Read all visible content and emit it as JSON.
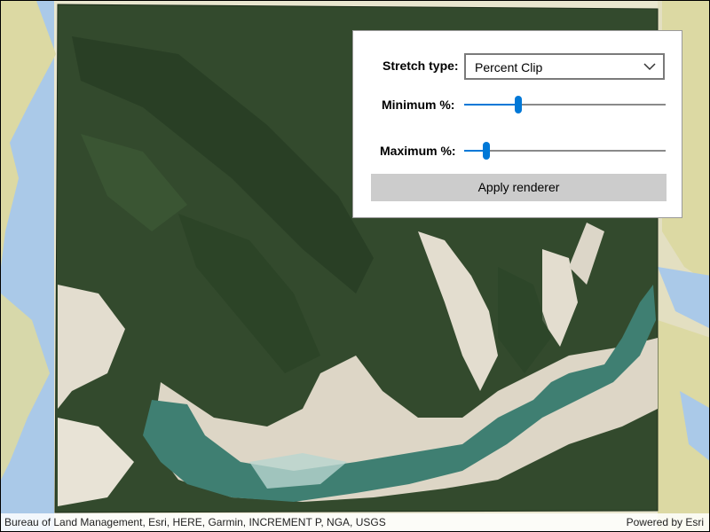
{
  "panel": {
    "stretch_label": "Stretch type:",
    "stretch_value": "Percent Clip",
    "min_label": "Minimum %:",
    "min_value": 0.27,
    "max_label": "Maximum %:",
    "max_value": 0.11,
    "apply_label": "Apply renderer"
  },
  "attribution": {
    "sources": "Bureau of Land Management, Esri, HERE, Garmin, INCREMENT P, NGA, USGS",
    "powered_by": "Powered by Esri"
  },
  "colors": {
    "accent": "#0078d7",
    "water": "#a9c8e6",
    "land": "#e8e4c4",
    "park": "#dcd9a3",
    "forest": "#2f4a2a",
    "lake": "#3f7f72"
  }
}
